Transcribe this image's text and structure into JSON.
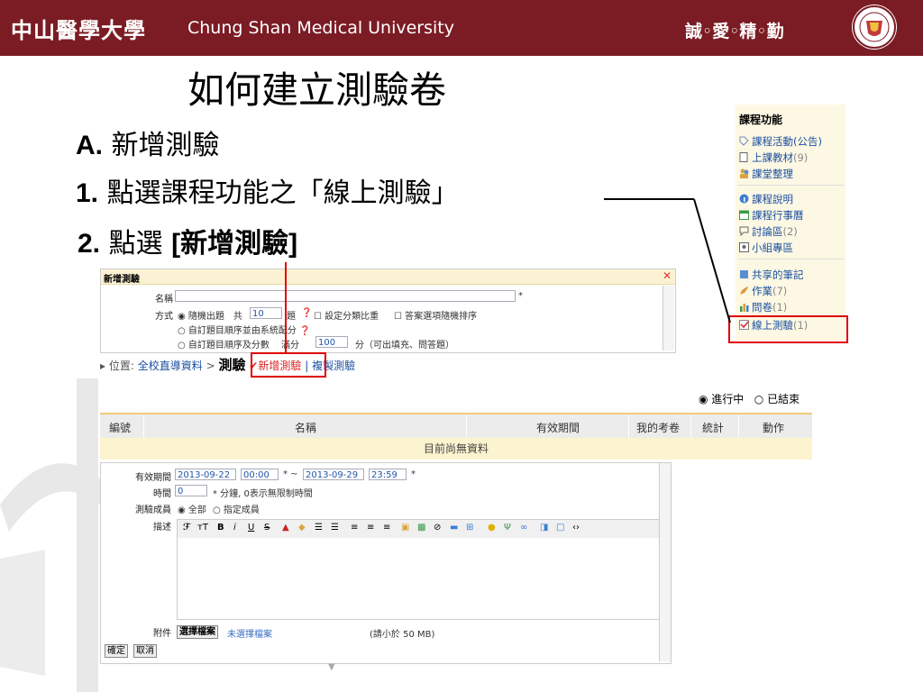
{
  "banner": {
    "cn_name": "中山醫學大學",
    "en_name": "Chung Shan Medical University",
    "motto": "誠◦愛◦精◦勤"
  },
  "slide": {
    "title": "如何建立測驗卷",
    "step_a_prefix": "A.",
    "step_a_text": " 新增測驗",
    "step_1_prefix": "1.",
    "step_1_text": " 點選課程功能之「線上測驗」",
    "step_2_prefix": "2.",
    "step_2_text": " 點選 ",
    "step_2_bracket": "[新增測驗]"
  },
  "sidebar": {
    "title": "課程功能",
    "items": [
      {
        "label": "課程活動(公告)",
        "count": "",
        "icon": "tag-icon"
      },
      {
        "label": "上課教材",
        "count": "(9)",
        "icon": "document-icon"
      },
      {
        "label": "課堂整理",
        "count": "",
        "icon": "people-icon"
      },
      {
        "label": "課程說明",
        "count": "",
        "icon": "info-icon"
      },
      {
        "label": "課程行事曆",
        "count": "",
        "icon": "calendar-icon"
      },
      {
        "label": "討論區",
        "count": "(2)",
        "icon": "chat-icon"
      },
      {
        "label": "小組專區",
        "count": "",
        "icon": "group-icon"
      },
      {
        "label": "共享的筆記",
        "count": "",
        "icon": "note-icon"
      },
      {
        "label": "作業",
        "count": "(7)",
        "icon": "pencil-icon"
      },
      {
        "label": "問卷",
        "count": "(1)",
        "icon": "bar-chart-icon"
      },
      {
        "label": "線上測驗",
        "count": "(1)",
        "icon": "checkbox-icon"
      }
    ]
  },
  "form1": {
    "header": "新增測驗",
    "name_label": "名稱",
    "name_value": "",
    "required_mark": "*",
    "method_label": "方式",
    "opt_random": "隨機出題　共",
    "random_count": "10",
    "opt_random_suffix": "題",
    "opt_ratio": "設定分類比重",
    "opt_shuffle": "答案選項隨機排序",
    "opt_order_auto": "自訂題目順序並由系統配分",
    "opt_order_score": "自訂題目順序及分數",
    "full_score_label": "滿分",
    "full_score_value": "100",
    "full_score_suffix": "分（可出填充、問答題）"
  },
  "breadcrumb": {
    "prefix": "位置:",
    "link": "全校直導資料",
    "sep": ">",
    "current": "測驗",
    "add": "新增測驗",
    "copy": "複製測驗"
  },
  "status_filter": {
    "ongoing": "進行中",
    "ended": "已結束",
    "selected": "進行中"
  },
  "table": {
    "columns": [
      "編號",
      "名稱",
      "有效期間",
      "我的考卷",
      "統計",
      "動作"
    ],
    "empty_text": "目前尚無資料"
  },
  "form2": {
    "period_label": "有效期間",
    "start_date": "2013-09-22",
    "start_time": "00:00",
    "tilde": "* ~",
    "end_date": "2013-09-29",
    "end_time": "23:59",
    "end_mark": "*",
    "duration_label": "時間",
    "duration_value": "0",
    "duration_note": "* 分鐘, 0表示無限制時間",
    "members_label": "測驗成員",
    "members_all": "全部",
    "members_specific": "指定成員",
    "desc_label": "描述",
    "attach_label": "附件",
    "file_button": "選擇檔案",
    "file_status": "未選擇檔案",
    "file_limit": "(請小於 50 MB)",
    "ok_button": "確定",
    "cancel_button": "取消"
  },
  "colors": {
    "banner": "#7b1c24",
    "highlight": "#e00000",
    "link": "#1a4fa0"
  }
}
